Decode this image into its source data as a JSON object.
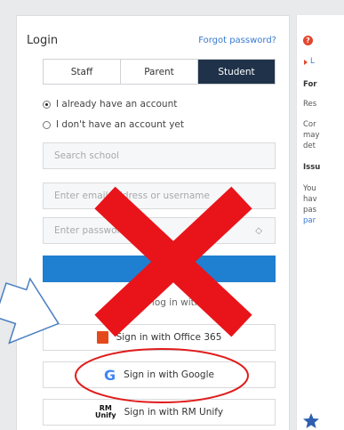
{
  "login": {
    "title": "Login",
    "forgot_link": "Forgot password?",
    "tabs": [
      {
        "label": "Staff",
        "active": false
      },
      {
        "label": "Parent",
        "active": false
      },
      {
        "label": "Student",
        "active": true
      }
    ],
    "radio_options": [
      {
        "label": "I already have an account",
        "selected": true
      },
      {
        "label": "I don't have an account yet",
        "selected": false
      }
    ],
    "search_school_placeholder": "Search school",
    "email_placeholder": "Enter email address or username",
    "password_placeholder": "Enter password",
    "or_text": "Or log in with",
    "sso": {
      "office": "Sign in with Office 365",
      "google": "Sign in with Google",
      "rm": "Sign in with RM Unify",
      "rm_logo_top": "RM",
      "rm_logo_bottom": "Unify"
    }
  },
  "side_panel": {
    "line1": "L",
    "line2": "For",
    "line3": "Res",
    "line4": "Cor",
    "line5": "may",
    "line6": "det",
    "line7": "Issu",
    "line8": "You",
    "line9": "hav",
    "line10": "pas",
    "line11": "par"
  },
  "colors": {
    "active_tab": "#1f3249",
    "login_button": "#1f7fd0",
    "x_mark": "#e8141a",
    "circle": "#e01c1c",
    "arrow_fill": "#ffffff",
    "arrow_stroke": "#4a7fc0",
    "office_icon": "#e4491b",
    "google_icon": "#4285f4"
  },
  "icons": {
    "help": "help-circle-icon",
    "eye": "eye-icon",
    "office": "office-365-icon",
    "google": "google-g-icon",
    "rm": "rm-unify-icon"
  }
}
